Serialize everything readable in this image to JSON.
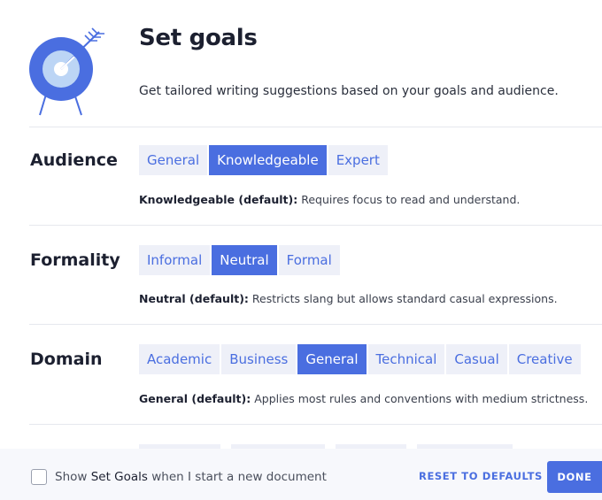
{
  "header": {
    "title": "Set goals",
    "subtitle": "Get tailored writing suggestions based on your goals and audience."
  },
  "colors": {
    "accent": "#4a6ee0",
    "chip_bg": "#eef0f8",
    "footer_bg": "#f7f8fc"
  },
  "icons": {
    "header": "target-arrow-icon"
  },
  "sections": [
    {
      "label": "Audience",
      "options": [
        "General",
        "Knowledgeable",
        "Expert"
      ],
      "selected": "Knowledgeable",
      "desc_strong": "Knowledgeable (default):",
      "desc_text": " Requires focus to read and understand."
    },
    {
      "label": "Formality",
      "options": [
        "Informal",
        "Neutral",
        "Formal"
      ],
      "selected": "Neutral",
      "desc_strong": "Neutral (default):",
      "desc_text": " Restricts slang but allows standard casual expressions."
    },
    {
      "label": "Domain",
      "options": [
        "Academic",
        "Business",
        "General",
        "Technical",
        "Casual",
        "Creative"
      ],
      "selected": "General",
      "desc_strong": "General (default):",
      "desc_text": " Applies most rules and conventions with medium strictness."
    }
  ],
  "footer": {
    "checkbox_checked": false,
    "check_prefix": "Show ",
    "check_strong": "Set Goals",
    "check_suffix": " when I start a new document",
    "reset_label": "RESET TO DEFAULTS",
    "done_label": "DONE"
  }
}
